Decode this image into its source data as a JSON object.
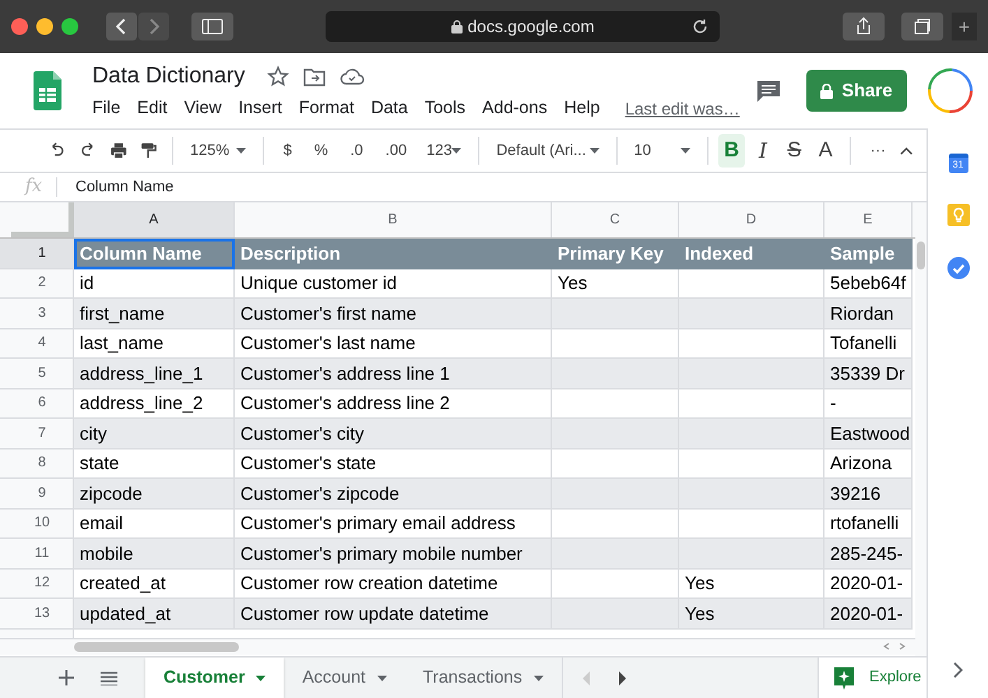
{
  "browser": {
    "address": "docs.google.com",
    "new_tab": "+"
  },
  "document": {
    "title": "Data Dictionary",
    "menu": [
      "File",
      "Edit",
      "View",
      "Insert",
      "Format",
      "Data",
      "Tools",
      "Add-ons",
      "Help"
    ],
    "last_edit": "Last edit was…",
    "share": "Share"
  },
  "toolbar": [
    {
      "kind": "icon"
    },
    {
      "kind": "icon"
    },
    {
      "kind": "icon"
    },
    {
      "kind": "icon"
    },
    {
      "kind": "sep"
    },
    {
      "kind": "dropdown",
      "label": "125%"
    },
    {
      "kind": "sep"
    },
    {
      "kind": "text",
      "label": "$"
    },
    {
      "kind": "text",
      "label": "%"
    },
    {
      "kind": "text",
      "label": ".0"
    },
    {
      "kind": "text",
      "label": ".00"
    },
    {
      "kind": "dropdown",
      "label": "123"
    },
    {
      "kind": "sep"
    },
    {
      "kind": "dropdown",
      "label": "Default (Ari..."
    },
    {
      "kind": "sep"
    },
    {
      "kind": "dropdown",
      "label": "10"
    },
    {
      "kind": "sep"
    },
    {
      "kind": "toggle",
      "label": "B",
      "on": true
    },
    {
      "kind": "toggle",
      "label": "I",
      "on": false
    },
    {
      "kind": "toggle",
      "label": "S",
      "on": false
    },
    {
      "kind": "toggle",
      "label": "A",
      "on": false
    },
    {
      "kind": "sep"
    },
    {
      "kind": "text",
      "label": "···"
    }
  ],
  "formula_bar": {
    "icon_label": "fx",
    "value": "Column Name"
  },
  "sheet": {
    "columns": [
      {
        "label": "A",
        "selected": true
      },
      {
        "label": "B",
        "selected": false
      },
      {
        "label": "C",
        "selected": false
      },
      {
        "label": "D",
        "selected": false
      },
      {
        "label": "E",
        "selected": false
      }
    ],
    "rows": [
      {
        "number": "1",
        "kind": "header",
        "selected": true,
        "cells": [
          "Column Name",
          "Description",
          "Primary Key",
          "Indexed",
          "Sample"
        ]
      },
      {
        "number": "2",
        "kind": "data",
        "selected": false,
        "cells": [
          "id",
          "Unique customer id",
          "Yes",
          "",
          "5ebeb64f"
        ]
      },
      {
        "number": "3",
        "kind": "data",
        "selected": false,
        "cells": [
          "first_name",
          "Customer's first name",
          "",
          "",
          "Riordan"
        ]
      },
      {
        "number": "4",
        "kind": "data",
        "selected": false,
        "cells": [
          "last_name",
          "Customer's last name",
          "",
          "",
          "Tofanelli"
        ]
      },
      {
        "number": "5",
        "kind": "data",
        "selected": false,
        "cells": [
          "address_line_1",
          "Customer's address line 1",
          "",
          "",
          "35339 Dr"
        ]
      },
      {
        "number": "6",
        "kind": "data",
        "selected": false,
        "cells": [
          "address_line_2",
          "Customer's address line 2",
          "",
          "",
          "-"
        ]
      },
      {
        "number": "7",
        "kind": "data",
        "selected": false,
        "cells": [
          "city",
          "Customer's city",
          "",
          "",
          "Eastwood"
        ]
      },
      {
        "number": "8",
        "kind": "data",
        "selected": false,
        "cells": [
          "state",
          "Customer's state",
          "",
          "",
          "Arizona"
        ]
      },
      {
        "number": "9",
        "kind": "data",
        "selected": false,
        "cells": [
          "zipcode",
          "Customer's zipcode",
          "",
          "",
          "39216"
        ]
      },
      {
        "number": "10",
        "kind": "data",
        "selected": false,
        "cells": [
          "email",
          "Customer's primary email address",
          "",
          "",
          "rtofanelli"
        ]
      },
      {
        "number": "11",
        "kind": "data",
        "selected": false,
        "cells": [
          "mobile",
          "Customer's primary mobile number",
          "",
          "",
          "285-245-"
        ]
      },
      {
        "number": "12",
        "kind": "data",
        "selected": false,
        "cells": [
          "created_at",
          "Customer row creation datetime",
          "",
          "Yes",
          "2020-01-"
        ]
      },
      {
        "number": "13",
        "kind": "data",
        "selected": false,
        "cells": [
          "updated_at",
          "Customer row update datetime",
          "",
          "Yes",
          "2020-01-"
        ]
      }
    ]
  },
  "sheet_tabs": [
    {
      "label": "Customer",
      "selected": true
    },
    {
      "label": "Account",
      "selected": false
    },
    {
      "label": "Transactions",
      "selected": false
    }
  ],
  "explore": "Explore",
  "side_panel": {
    "calendar_label": "31"
  }
}
